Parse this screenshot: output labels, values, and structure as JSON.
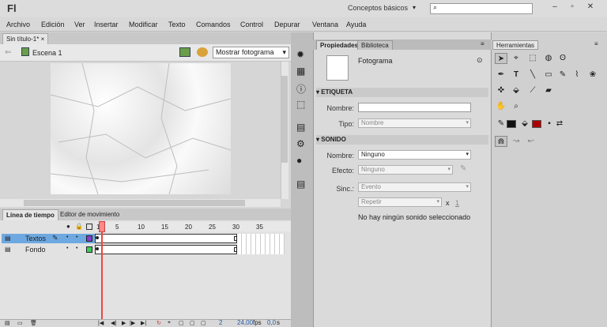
{
  "app": {
    "logo": "Fl",
    "workspace": "Conceptos básicos",
    "search_placeholder": ""
  },
  "menu": [
    "Archivo",
    "Edición",
    "Ver",
    "Insertar",
    "Modificar",
    "Texto",
    "Comandos",
    "Control",
    "Depurar",
    "Ventana",
    "Ayuda"
  ],
  "document": {
    "tab": "Sin título-1*",
    "scene": "Escena 1",
    "zoom": "Mostrar fotograma"
  },
  "timeline": {
    "tabs": [
      "Línea de tiempo",
      "Editor de movimiento"
    ],
    "ruler": [
      "1",
      "5",
      "10",
      "15",
      "20",
      "25",
      "30",
      "35"
    ],
    "layers": [
      {
        "name": "Textos",
        "color": "#8a3ad0"
      },
      {
        "name": "Fondo",
        "color": "#3ad05a"
      }
    ],
    "footer": {
      "frame": "2",
      "fps": "24,00",
      "fps_label": "fps",
      "time": "0,0",
      "time_unit": "s"
    }
  },
  "properties": {
    "tabs": [
      "Propiedades",
      "Biblioteca"
    ],
    "object": "Fotograma",
    "label_section": "ETIQUETA",
    "name_label": "Nombre:",
    "name_value": "",
    "type_label": "Tipo:",
    "type_value": "Nombre",
    "sound_section": "SONIDO",
    "sound_name_label": "Nombre:",
    "sound_name_value": "Ninguno",
    "effect_label": "Efecto:",
    "effect_value": "Ninguno",
    "sync_label": "Sinc.:",
    "sync_value": "Evento",
    "repeat_value": "Repetir",
    "repeat_x": "x",
    "repeat_count": "1",
    "status": "No hay ningún sonido seleccionado"
  },
  "tools": {
    "title": "Herramientas",
    "stroke_color": "#111111",
    "fill_color": "#aa0000"
  }
}
